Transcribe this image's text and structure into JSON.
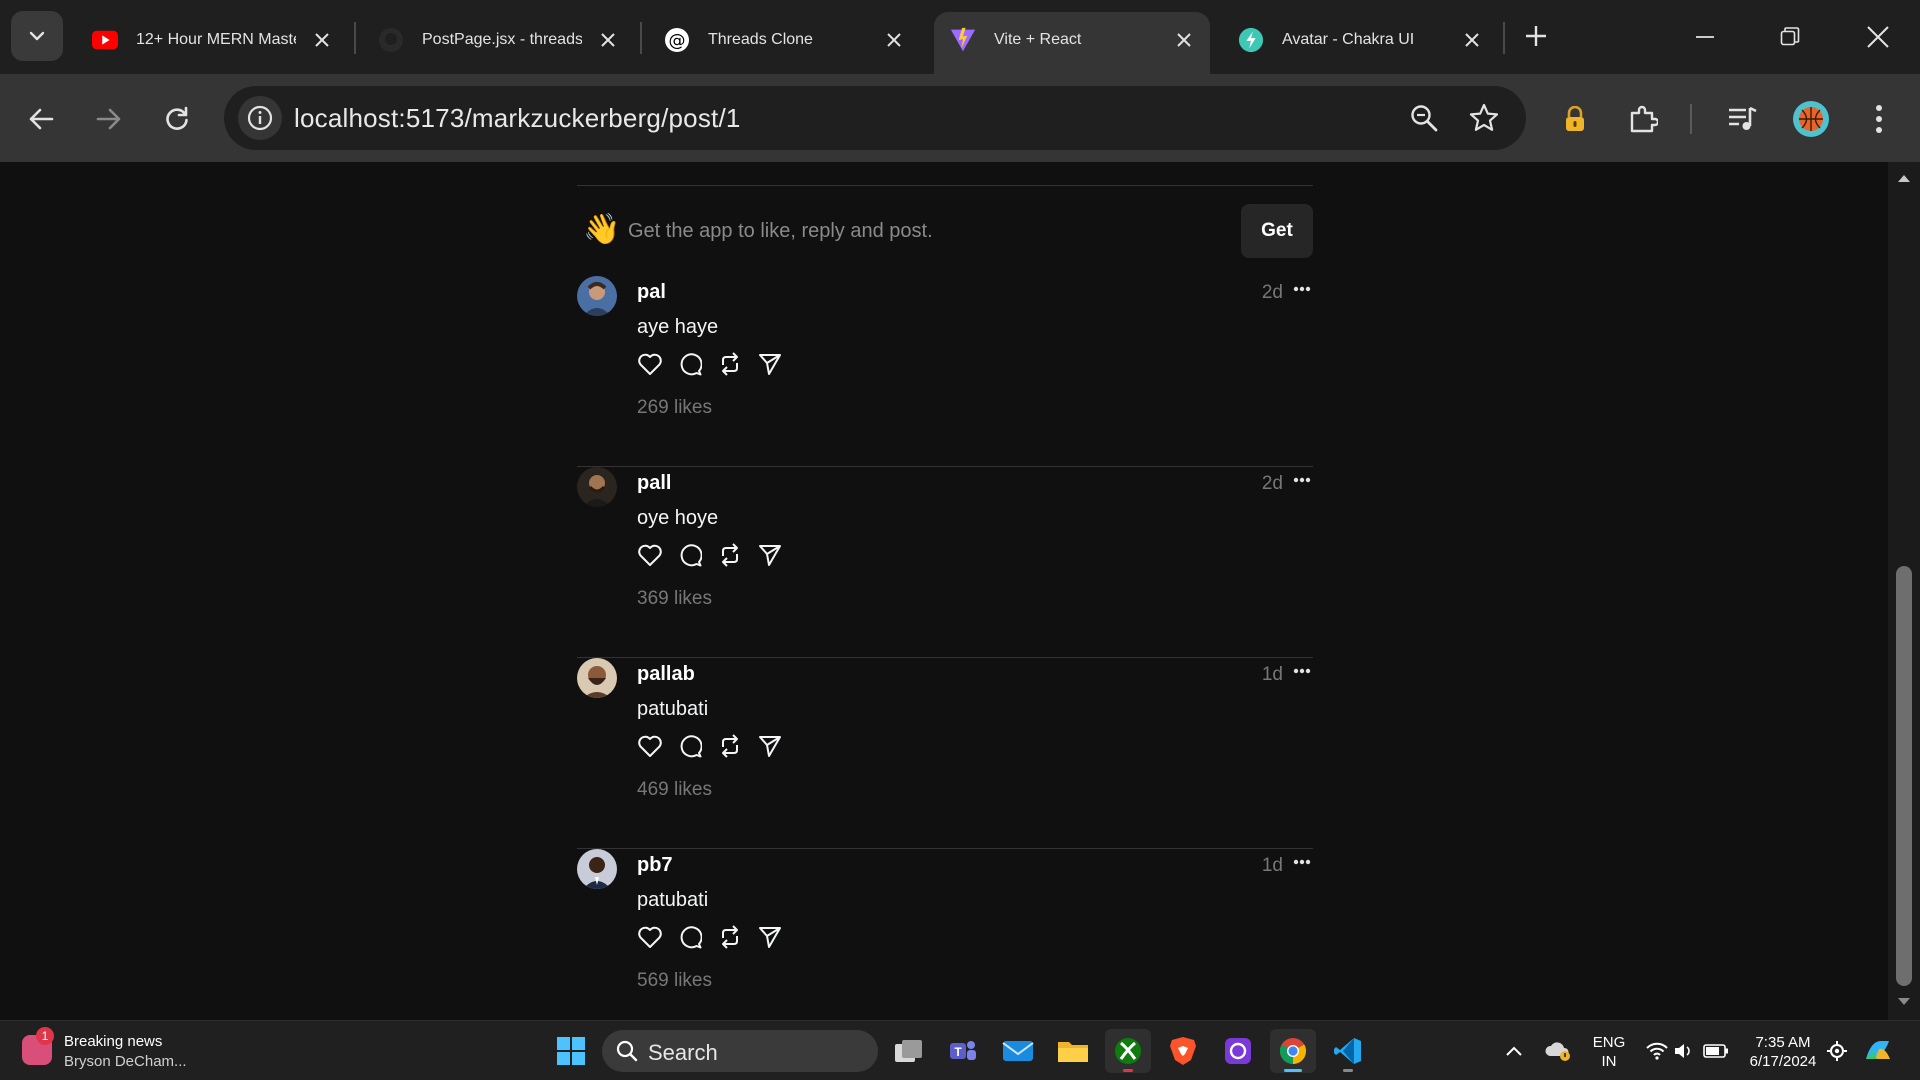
{
  "browser": {
    "tabs": [
      {
        "title": "12+ Hour MERN Maste",
        "favicon": "youtube-icon"
      },
      {
        "title": "PostPage.jsx - threads-c",
        "favicon": "github-icon"
      },
      {
        "title": "Threads Clone",
        "favicon": "threads-icon"
      },
      {
        "title": "Vite + React",
        "favicon": "vite-icon",
        "active": true
      },
      {
        "title": "Avatar - Chakra UI",
        "favicon": "chakra-icon"
      }
    ],
    "url": "localhost:5173/markzuckerberg/post/1"
  },
  "page": {
    "get_app": {
      "text": "Get the app to like, reply and post.",
      "button": "Get",
      "emoji": "👋"
    },
    "comments": [
      {
        "username": "pal",
        "time": "2d",
        "text": "aye haye",
        "likes": "269 likes",
        "avatar_color": "#4a6fa5"
      },
      {
        "username": "pall",
        "time": "2d",
        "text": "oye hoye",
        "likes": "369 likes",
        "avatar_color": "#6b4f3a"
      },
      {
        "username": "pallab",
        "time": "1d",
        "text": "patubati",
        "likes": "469 likes",
        "avatar_color": "#8a6a4a"
      },
      {
        "username": "pb7",
        "time": "1d",
        "text": "patubati",
        "likes": "569 likes",
        "avatar_color": "#3a4a6a"
      }
    ]
  },
  "taskbar": {
    "news_title": "Breaking news",
    "news_sub": "Bryson DeCham...",
    "news_badge": "1",
    "search_label": "Search",
    "lang_1": "ENG",
    "lang_2": "IN",
    "time": "7:35 AM",
    "date": "6/17/2024"
  }
}
